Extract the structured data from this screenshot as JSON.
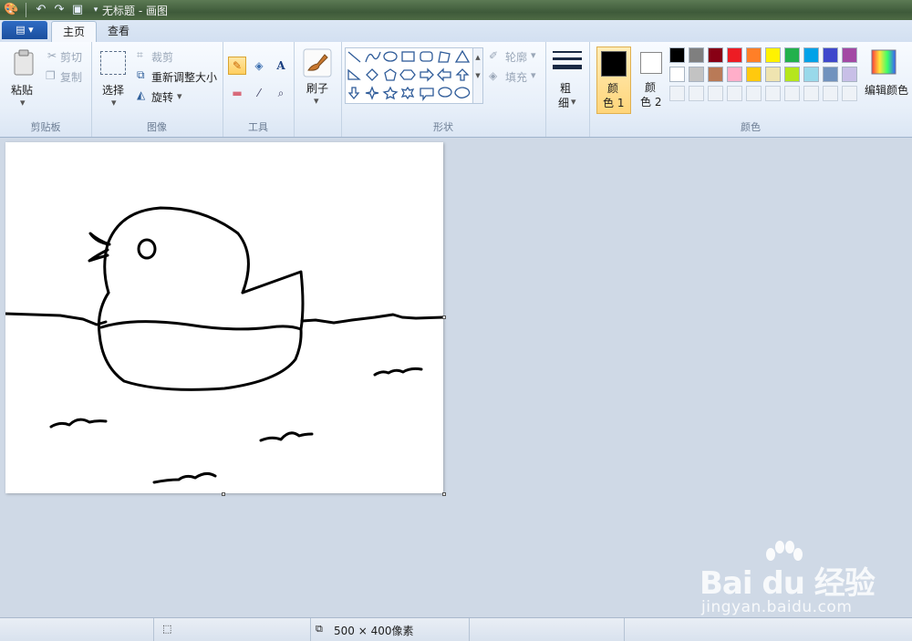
{
  "window": {
    "title": "无标题 - 画图"
  },
  "tabs": {
    "app_menu": "▤ ▾",
    "home": "主页",
    "view": "查看"
  },
  "clipboard": {
    "paste": "粘贴",
    "cut": "剪切",
    "copy": "复制",
    "group": "剪贴板"
  },
  "image": {
    "select": "选择",
    "crop": "裁剪",
    "resize": "重新调整大小",
    "rotate": "旋转",
    "group": "图像"
  },
  "tools": {
    "group": "工具",
    "text_glyph": "A"
  },
  "brushes": {
    "label": "刷子"
  },
  "shapes": {
    "outline": "轮廓",
    "fill": "填充",
    "group": "形状"
  },
  "size": {
    "label_top": "粗",
    "label_bottom": "细"
  },
  "colors": {
    "color1_top": "颜",
    "color1_bottom": "色 1",
    "color2_top": "颜",
    "color2_bottom": "色 2",
    "edit": "编辑颜色",
    "group": "颜色",
    "color1_value": "#000000",
    "color2_value": "#ffffff",
    "palette_row1": [
      "#000000",
      "#7f7f7f",
      "#880015",
      "#ed1c24",
      "#ff7f27",
      "#fff200",
      "#22b14c",
      "#00a2e8",
      "#3f48cc",
      "#a349a4"
    ],
    "palette_row2": [
      "#ffffff",
      "#c3c3c3",
      "#b97a57",
      "#ffaec9",
      "#ffc90e",
      "#efe4b0",
      "#b5e61d",
      "#99d9ea",
      "#7092be",
      "#c8bfe7"
    ]
  },
  "status": {
    "canvas_size": "500 × 400像素"
  },
  "watermark": {
    "logo": "Bai du 经验",
    "url": "jingyan.baidu.com"
  }
}
